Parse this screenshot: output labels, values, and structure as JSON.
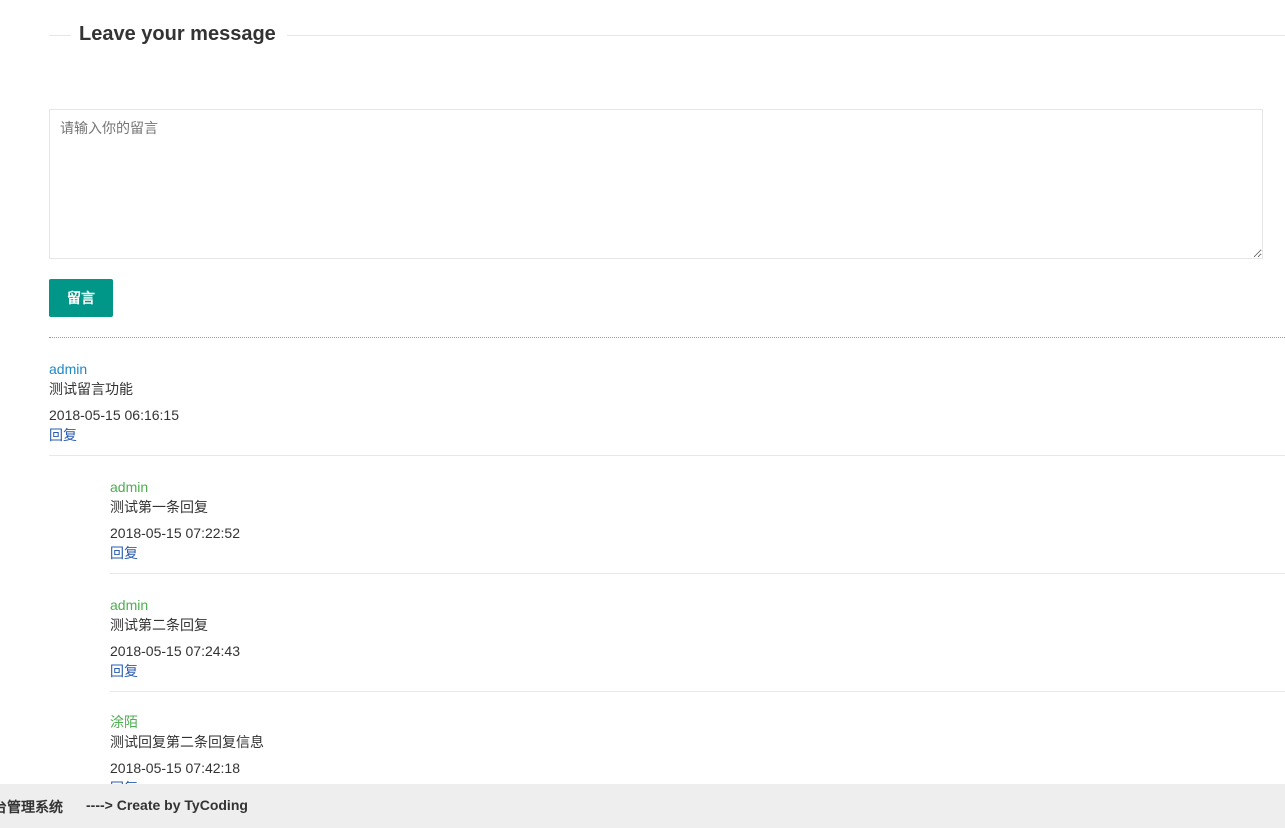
{
  "header": {
    "title": "Leave your message"
  },
  "form": {
    "placeholder": "请输入你的留言",
    "value": "",
    "submit_label": "留言"
  },
  "comments": [
    {
      "author": "admin",
      "text": "测试留言功能",
      "time": "2018-05-15 06:16:15",
      "reply_label": "回复",
      "replies": [
        {
          "author": "admin",
          "text": "测试第一条回复",
          "time": "2018-05-15 07:22:52",
          "reply_label": "回复"
        },
        {
          "author": "admin",
          "text": "测试第二条回复",
          "time": "2018-05-15 07:24:43",
          "reply_label": "回复"
        },
        {
          "author": "涂陌",
          "text": "测试回复第二条回复信息",
          "time": "2018-05-15 07:42:18",
          "reply_label": "回复"
        }
      ]
    }
  ],
  "footer": {
    "system_name": "台管理系统",
    "credit": "----> Create by TyCoding"
  },
  "colors": {
    "accent": "#009688",
    "author_primary": "#1e88c7",
    "author_reply": "#4caf50",
    "link": "#2a5db0"
  }
}
